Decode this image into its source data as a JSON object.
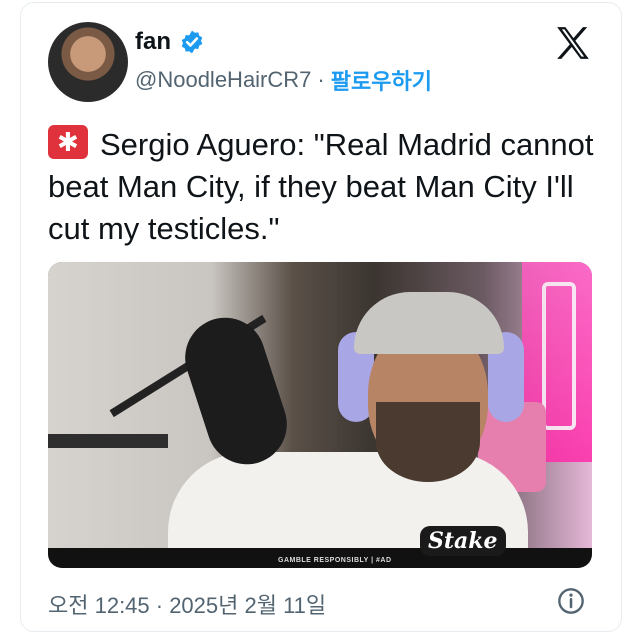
{
  "author": {
    "display_name": "fan",
    "handle": "@NoodleHairCR7",
    "separator": "·",
    "follow_label": "팔로우하기"
  },
  "tweet": {
    "text": "Sergio Aguero: \"Real Madrid cannot beat Man City, if they beat Man City I'll cut my testicles.\""
  },
  "media": {
    "gamble_text": "GAMBLE RESPONSIBLY | #AD",
    "brand": "Stake"
  },
  "timestamp": "오전 12:45 · 2025년 2월 11일",
  "colors": {
    "follow_blue": "#1d9bf0",
    "verified_blue": "#1d9bf0",
    "secondary_text": "#536471"
  },
  "icons": {
    "verified": "verified-badge-icon",
    "platform": "x-logo-icon",
    "emoji": "police-siren-icon",
    "info": "info-icon"
  }
}
